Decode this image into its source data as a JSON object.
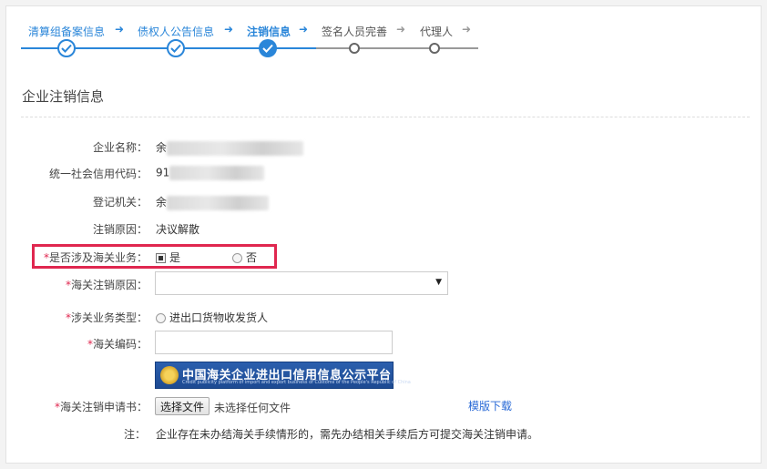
{
  "stepper": {
    "steps": [
      {
        "label": "清算组备案信息",
        "state": "done"
      },
      {
        "label": "债权人公告信息",
        "state": "done"
      },
      {
        "label": "注销信息",
        "state": "current"
      },
      {
        "label": "签名人员完善",
        "state": "pending"
      },
      {
        "label": "代理人",
        "state": "pending"
      }
    ],
    "arrow": "➜"
  },
  "section": {
    "title": "企业注销信息"
  },
  "fields": {
    "company_name": {
      "label": "企业名称：",
      "value": "余"
    },
    "credit_code": {
      "label": "统一社会信用代码：",
      "value": "91"
    },
    "authority": {
      "label": "登记机关：",
      "value": "余"
    },
    "reason": {
      "label": "注销原因：",
      "value": "决议解散"
    },
    "customs_involved": {
      "req": "*",
      "label": "是否涉及海关业务：",
      "option_yes": "是",
      "option_no": "否",
      "selected": "是"
    },
    "customs_reason": {
      "req": "*",
      "label": "海关注销原因：",
      "value": ""
    },
    "business_type": {
      "req": "*",
      "label": "涉关业务类型：",
      "option": "进出口货物收发货人"
    },
    "customs_code": {
      "req": "*",
      "label": "海关编码：",
      "value": ""
    },
    "application": {
      "req": "*",
      "label": "海关注销申请书：",
      "button": "选择文件",
      "status": "未选择任何文件",
      "template_link": "模版下载"
    }
  },
  "banner": {
    "title": "中国海关企业进出口信用信息公示平台",
    "subtitle": "Credit publicity platform of import and export business of Customs of the People's Republic of China"
  },
  "note": {
    "label": "注：",
    "text": "企业存在未办结海关手续情形的，需先办结相关手续后方可提交海关注销申请。"
  },
  "colors": {
    "accent": "#2a86d9",
    "required": "#e0274f",
    "link": "#2a6ad6"
  }
}
